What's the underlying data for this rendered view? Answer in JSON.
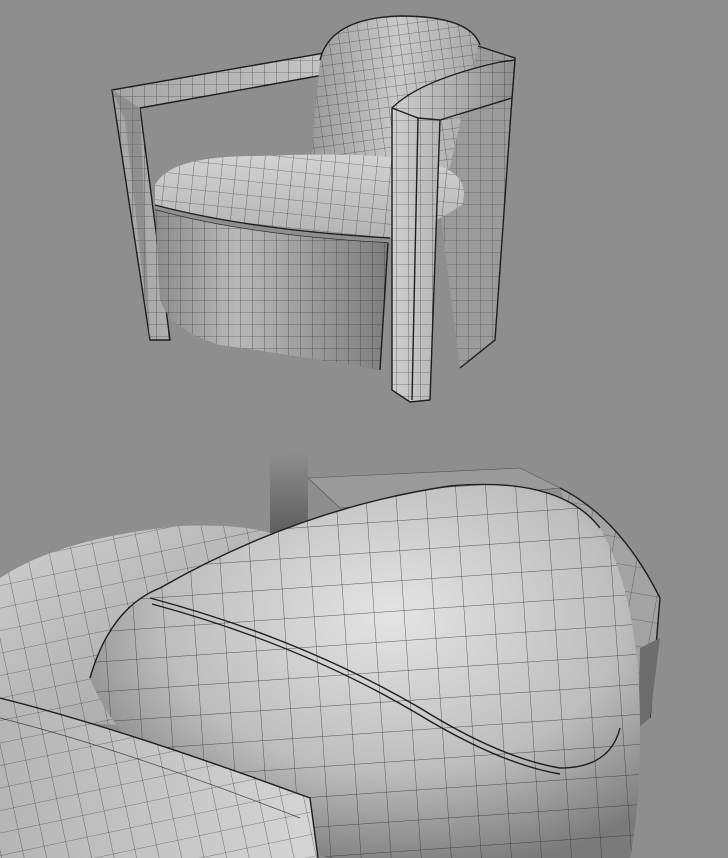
{
  "scene": {
    "background_color": "#8e8e8e",
    "subject": "armchair-wireframe",
    "views": [
      "full-chair",
      "seat-closeup"
    ]
  }
}
